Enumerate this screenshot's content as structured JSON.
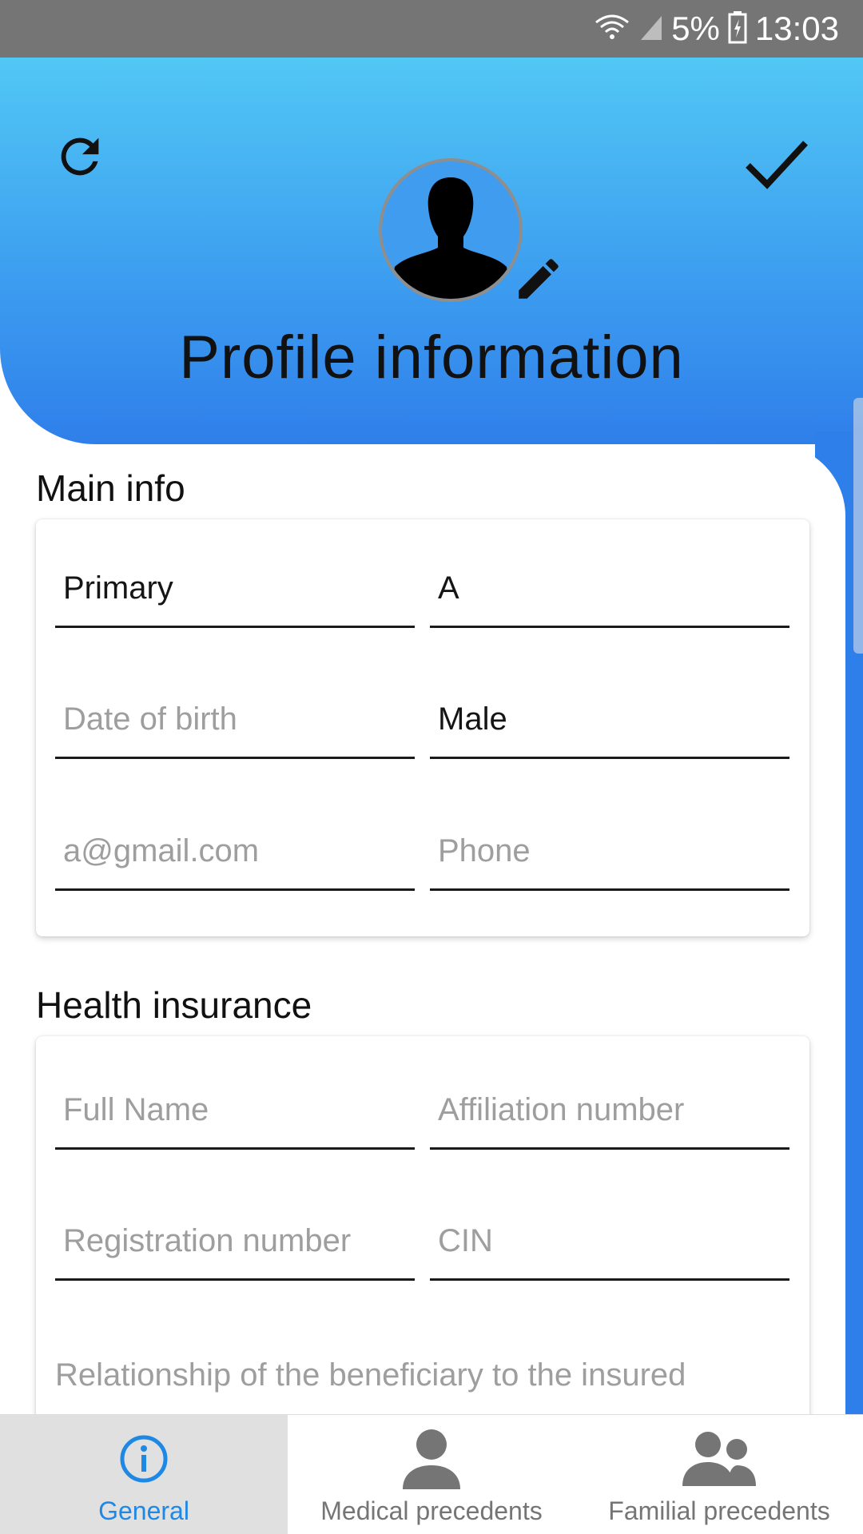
{
  "status_bar": {
    "battery": "5%",
    "time": "13:03",
    "icons": [
      "wifi-icon",
      "signal-icon",
      "battery-icon"
    ]
  },
  "header": {
    "title": "Profile information",
    "icons": {
      "refresh": "refresh-icon",
      "save": "check-icon",
      "avatar": "person-silhouette",
      "edit": "pencil-icon"
    }
  },
  "main_info": {
    "title": "Main info",
    "first_name": {
      "value": "Primary"
    },
    "last_name": {
      "value": "A"
    },
    "date_of_birth": {
      "placeholder": "Date of birth"
    },
    "gender": {
      "value": "Male"
    },
    "email": {
      "placeholder": "a@gmail.com"
    },
    "phone": {
      "placeholder": "Phone"
    }
  },
  "health_insurance": {
    "title": "Health insurance",
    "full_name": {
      "placeholder": "Full Name"
    },
    "affiliation_number": {
      "placeholder": "Affiliation number"
    },
    "registration_number": {
      "placeholder": "Registration number"
    },
    "cin": {
      "placeholder": "CIN"
    },
    "relationship": {
      "placeholder": "Relationship of the beneficiary to the insured"
    }
  },
  "bottom_nav": {
    "tabs": [
      {
        "label": "General",
        "icon": "info-icon",
        "active": true
      },
      {
        "label": "Medical precedents",
        "icon": "person-icon",
        "active": false
      },
      {
        "label": "Familial precedents",
        "icon": "people-icon",
        "active": false
      }
    ]
  },
  "colors": {
    "gradient_top": "#52c8f5",
    "gradient_bottom": "#2f7fea",
    "active_tab": "#1e88e5",
    "status_bar": "#757575"
  }
}
